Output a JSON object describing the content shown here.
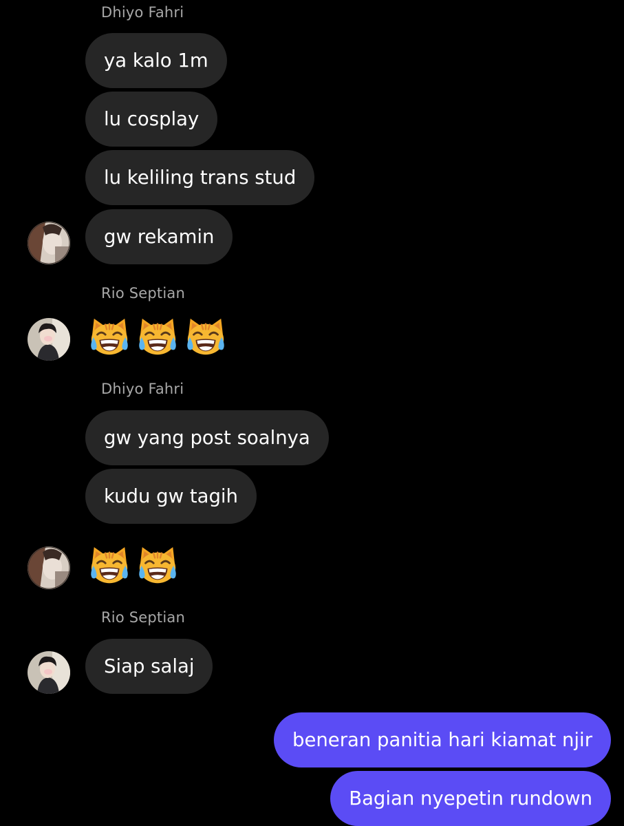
{
  "contacts": {
    "dhiyo": {
      "name": "Dhiyo Fahri",
      "avatar_icon": "avatar-dhiyo-icon"
    },
    "rio": {
      "name": "Rio Septian",
      "avatar_icon": "avatar-rio-icon"
    }
  },
  "colors": {
    "background": "#000000",
    "incoming_bubble": "#262626",
    "outgoing_bubble": "#5b4cf5",
    "sender_name": "#a8a8a8",
    "message_text": "#ffffff"
  },
  "messages": {
    "group1": {
      "sender": "Dhiyo Fahri",
      "lines": [
        "ya kalo 1m",
        "lu cosplay",
        "lu keliling trans stud",
        "gw rekamin"
      ]
    },
    "group2": {
      "sender": "Rio Septian",
      "emoji": "laughing-cat-emoji",
      "emoji_count": 3
    },
    "group3": {
      "sender": "Dhiyo Fahri",
      "lines": [
        "gw yang post soalnya",
        "kudu gw tagih"
      ],
      "emoji": "laughing-cat-emoji",
      "emoji_count": 2
    },
    "group4": {
      "sender": "Rio Septian",
      "lines": [
        "Siap salaj"
      ]
    },
    "outgoing": {
      "lines": [
        "beneran panitia hari kiamat njir",
        "Bagian nyepetin rundown"
      ]
    }
  }
}
